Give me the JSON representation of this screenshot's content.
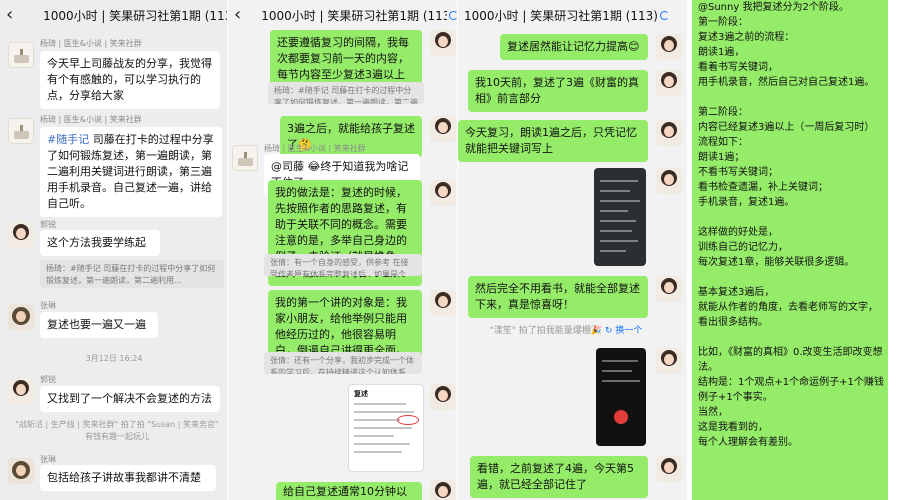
{
  "p1": {
    "title": "1000小时 | 笑果研习社第1期 (113)",
    "msg1": {
      "sender": "杨琦 | 医生&小说 | 笑来社群",
      "text": "今天早上司藤战友的分享，我觉得有个有感触的，可以学习执行的点，分享给大家"
    },
    "msg2": {
      "sender": "杨琦 | 医生&小说 | 笑来社群",
      "tag": "#随手记",
      "text": " 司藤在打卡的过程中分享了如何锻炼复述，第一遍朗读，第二遍利用关键词进行朗读，第三遍用手机录音。自己复述一遍，讲给自己听。"
    },
    "msg3": {
      "sender": "郭锐",
      "text": "这个方法我要学练起",
      "quote": "杨琦：#随手记 司藤在打卡的过程中分享了如何锻炼复述，第一遍朗读，第二遍利用..."
    },
    "msg4": {
      "sender": "张琳",
      "text": "复述也要一遍又一遍"
    },
    "time": "3月12日 16:24",
    "msg5": {
      "sender": "郭锐",
      "text": "又找到了一个解决不会复述的方法"
    },
    "system": "\"战斩活 | 生产线 | 笑来社群\" 拍了拍 \"Susan | 笑来务官\" 有钱有趣一起玩儿",
    "msg6": {
      "sender": "张琳",
      "text": "包括给孩子讲故事我都讲不清楚"
    }
  },
  "p2": {
    "title": "1000小时 | 笑果研习社第1期 (113)",
    "m1": "还要遵循复习的间隔，我每次都要复习前一天的内容，每节内容至少复述3遍以上",
    "q1": "杨琦：#随手记 司藤在打卡的过程中分享了如何锻炼复述，第一遍朗读，第二遍利用...",
    "m2": "3遍之后，就能给孩子复述了🤔",
    "sender3": "杨琦 | 医生&小说 | 笑来社群",
    "m3": "@司藤 😂终于知道我为啥记不住了",
    "m4": "我的做法是：复述的时候，先按照作者的思路复述，有助于关联不同的概念。需要注意的是，多举自己身边的例子，去验证（就是换角度），能加深对内容的理解。",
    "q2": "张倩：有一个自身的感受，供参考 在接受作者原有体系完整复述后，如果是个尚...",
    "m5": "我的第一个讲的对象是：我家小朋友，给他举例只能用他经历过的，他很容易明白，倒逼自己讲得更全面。",
    "q3": "张倩：还有一个分享，我初步完成一个体系的学习后，在持续精进这个认知体系的...",
    "doc_title": "复述",
    "m6": "给自己复述通常10分钟以内完成"
  },
  "p3": {
    "title": "1000小时 | 笑果研习社第1期 (113)",
    "m1": "复述居然能让记忆力提高😊",
    "m2": "我10天前，复述了3遍《财富的真相》前言部分",
    "m3": "今天复习，朗读1遍之后，只凭记忆就能把关键词写上",
    "m4": "然后完全不用看书，就能全部复述下来，真是惊喜呀！",
    "pat": "\"漾笙\" 拍了拍我能量爆棚🎉",
    "swap": "换一个",
    "m5": "看错，之前复述了4遍，今天第5遍，就已经全部记住了"
  },
  "p4": {
    "lines": [
      "@Sunny 我把复述分为2个阶段。",
      " 第一阶段：",
      "复述3遍之前的流程：",
      "朗读1遍，",
      "看着书写关键词，",
      "用手机录音，然后自己对自己复述1遍。",
      "",
      "第二阶段：",
      "内容已经复述3遍以上（一周后复习时）流程如下：",
      "朗读1遍；",
      "不看书写关键词；",
      "看书检查遗漏，补上关键词；",
      "手机录音，复述1遍。",
      "",
      "这样做的好处是，",
      "训练自己的记忆力，",
      "每次复述1章，能够关联很多逻辑。",
      "",
      "基本复述3遍后，",
      "就能从作者的角度，去看老师写的文字，",
      "看出很多结构。",
      "",
      "比如，《财富的真相》0.改变生活即改变想法。",
      "结构是：1个观点+1个命运例子+1个赚钱例子+1个事实。",
      "当然，",
      "这是我看到的，",
      "每个人理解会有差别。"
    ]
  }
}
